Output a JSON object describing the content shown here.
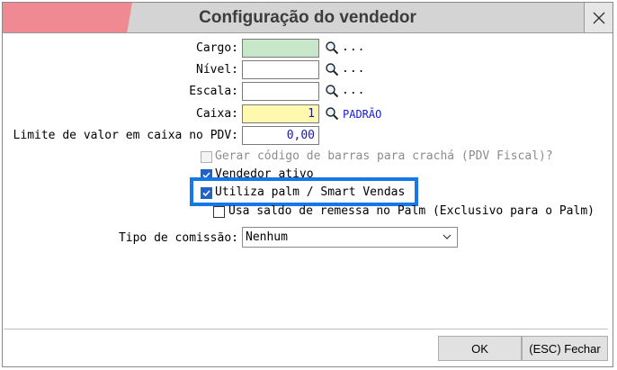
{
  "window": {
    "title": "Configuração do vendedor"
  },
  "form": {
    "cargo_label": "Cargo:",
    "cargo_value": "",
    "cargo_more": "...",
    "nivel_label": "Nível:",
    "nivel_value": "",
    "nivel_more": "...",
    "escala_label": "Escala:",
    "escala_value": "",
    "escala_more": "...",
    "caixa_label": "Caixa:",
    "caixa_value": "1",
    "caixa_link": "PADRÃO",
    "limite_label": "Limite de valor em caixa no PDV:",
    "limite_value": "0,00"
  },
  "checkboxes": [
    {
      "label": "Gerar código de barras para crachá (PDV Fiscal)?",
      "checked": false,
      "disabled": true
    },
    {
      "label": "Vendedor ativo",
      "checked": true,
      "disabled": false
    },
    {
      "label": "Utiliza palm / Smart Vendas",
      "checked": true,
      "disabled": false
    },
    {
      "label": "Usa saldo de remessa no Palm (Exclusivo para o Palm)",
      "checked": false,
      "disabled": false
    }
  ],
  "comissao": {
    "label": "Tipo de comissão:",
    "selected": "Nenhum"
  },
  "footer": {
    "ok_label": "OK",
    "cancel_label": "(ESC) Fechar"
  },
  "colors": {
    "title_accent": "#f08a92",
    "cargo_field_bg": "#c8e6c9",
    "caixa_field_bg": "#fff9b0",
    "checkbox_checked": "#1e63c8",
    "highlight_border": "#1678e8"
  },
  "icons": [
    "close-icon",
    "magnifier-icon",
    "checkmark-icon",
    "chevron-down-icon"
  ]
}
